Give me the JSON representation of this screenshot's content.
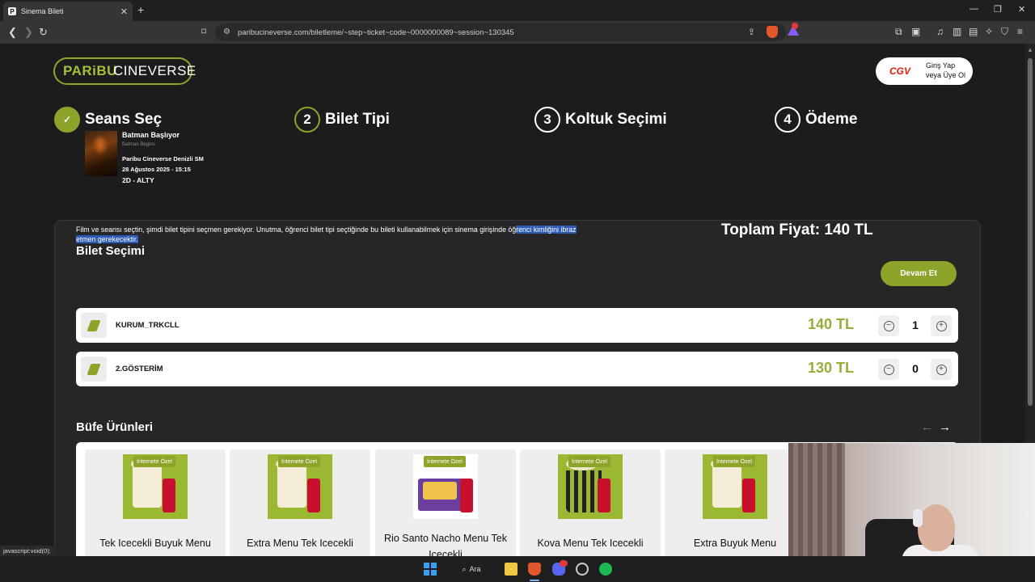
{
  "browser": {
    "tab_favicon": "P",
    "tab_title": "Sinema Bileti",
    "url": "paribucineverse.com/biletleme/~step~ticket~code~0000000089~session~130345",
    "status_url": "javascript:void(0);"
  },
  "header": {
    "logo_paribu": "PARiBU",
    "logo_cineverse": "CINEVERSE",
    "cgv_logo": "CGV",
    "login_line1": "Giriş Yap",
    "login_line2": "veya Üye Ol"
  },
  "steps": [
    {
      "number": "✓",
      "label": "Seans Seç"
    },
    {
      "number": "2",
      "label": "Bilet Tipi"
    },
    {
      "number": "3",
      "label": "Koltuk Seçimi"
    },
    {
      "number": "4",
      "label": "Ödeme"
    }
  ],
  "movie": {
    "title": "Batman Başlıyor",
    "original_title": "Batman Begins",
    "cinema": "Paribu Cineverse Denizli SM",
    "datetime": "28 Ağustos 2025 - 15:15",
    "format": "2D - ALTY"
  },
  "ticket_selection": {
    "title": "Bilet Seçimi",
    "notice_plain": "Film ve seansı seçtin, şimdi bilet tipini seçmen gerekiyor. Unutma, öğrenci bilet tipi seçtiğinde bu bileti kullanabilmek için sinema girişinde öğ",
    "notice_highlighted": "renci kimliğini ibraz etmen gerekecektir.",
    "total_label": "Toplam Fiyat:",
    "total_value": "140 TL",
    "continue_label": "Devam Et",
    "tickets": [
      {
        "name": "KURUM_TRKCLL",
        "price": "140 TL",
        "quantity": "1"
      },
      {
        "name": "2.GÖSTERİM",
        "price": "130 TL",
        "quantity": "0"
      }
    ]
  },
  "buffet": {
    "title": "Büfe Ürünleri",
    "products": [
      {
        "badge": "İnternete Özel",
        "name": "Tek Icecekli Buyuk Menu"
      },
      {
        "badge": "İnternete Özel",
        "name": "Extra Menu Tek Icecekli"
      },
      {
        "badge": "İnternete Özel",
        "name": "Rio Santo Nacho Menu Tek Icecekli"
      },
      {
        "badge": "İnternete Özel",
        "name": "Kova Menu Tek Icecekli"
      },
      {
        "badge": "İnternete Özel",
        "name": "Extra Buyuk Menu"
      }
    ]
  },
  "taskbar": {
    "search_label": "Ara"
  },
  "colors": {
    "accent": "#8da42a",
    "price": "#98ac3a",
    "background": "#1c1c1c",
    "card": "#262626"
  }
}
